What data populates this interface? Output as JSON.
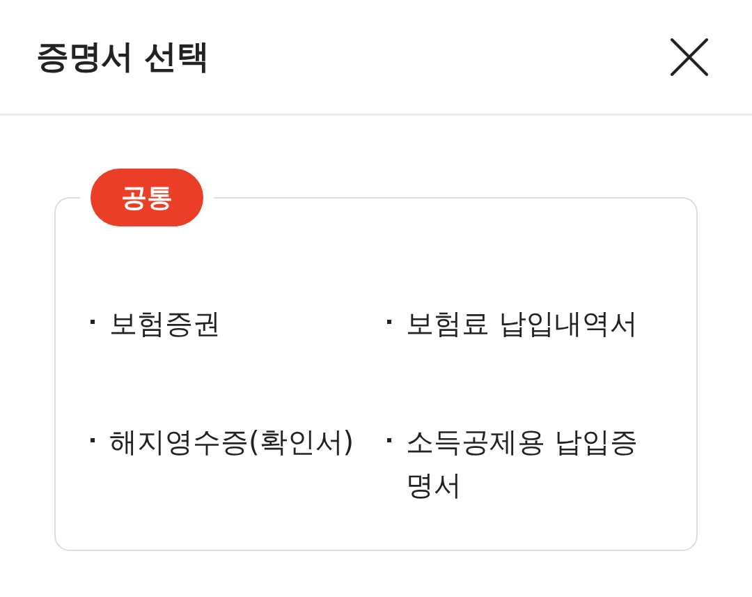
{
  "header": {
    "title": "증명서 선택"
  },
  "section": {
    "badge": "공통",
    "items": [
      "보험증권",
      "보험료 납입내역서",
      "해지영수증(확인서)",
      "소득공제용 납입증명서"
    ]
  }
}
